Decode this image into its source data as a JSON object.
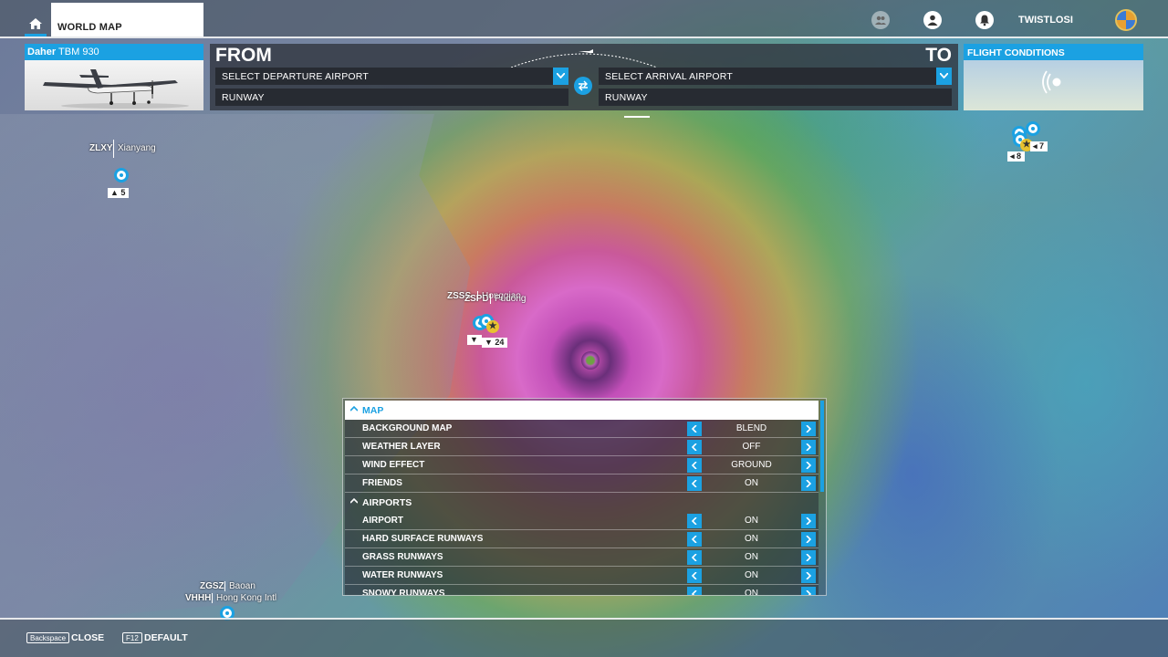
{
  "topbar": {
    "tab_label": "WORLD MAP",
    "username": "TWISTLOSI"
  },
  "aircraft": {
    "maker": "Daher",
    "model": "TBM 930"
  },
  "flight": {
    "from_label": "FROM",
    "to_label": "TO",
    "departure_placeholder": "SELECT DEPARTURE AIRPORT",
    "arrival_placeholder": "SELECT ARRIVAL AIRPORT",
    "departure_runway": "RUNWAY",
    "arrival_runway": "RUNWAY"
  },
  "conditions": {
    "title": "FLIGHT CONDITIONS"
  },
  "airports": {
    "xianyang": {
      "code": "ZLXY",
      "name": "Xianyang",
      "count": "5"
    },
    "pudong": {
      "code": "ZSSS",
      "code2": "ZSPD",
      "name": "Hongqiao",
      "name2": "Pudong",
      "count": "24"
    },
    "japan": {
      "count_a": "7",
      "count_b": "8"
    },
    "baoan": {
      "code": "ZGSZ",
      "name": "Baoan"
    },
    "hongkong": {
      "code": "VHHH",
      "name": "Hong Kong Intl"
    }
  },
  "settings": {
    "sections": [
      {
        "title": "MAP",
        "rows": [
          {
            "label": "BACKGROUND MAP",
            "value": "BLEND"
          },
          {
            "label": "WEATHER LAYER",
            "value": "OFF"
          },
          {
            "label": "WIND EFFECT",
            "value": "GROUND"
          },
          {
            "label": "FRIENDS",
            "value": "ON"
          }
        ]
      },
      {
        "title": "AIRPORTS",
        "rows": [
          {
            "label": "AIRPORT",
            "value": "ON"
          },
          {
            "label": "HARD SURFACE RUNWAYS",
            "value": "ON"
          },
          {
            "label": "GRASS RUNWAYS",
            "value": "ON"
          },
          {
            "label": "WATER RUNWAYS",
            "value": "ON"
          },
          {
            "label": "SNOWY RUNWAYS",
            "value": "ON"
          }
        ]
      }
    ]
  },
  "bottombar": {
    "close_key": "Backspace",
    "close_label": "CLOSE",
    "default_key": "F12",
    "default_label": "DEFAULT"
  },
  "colors": {
    "accent": "#1ba1e2"
  }
}
